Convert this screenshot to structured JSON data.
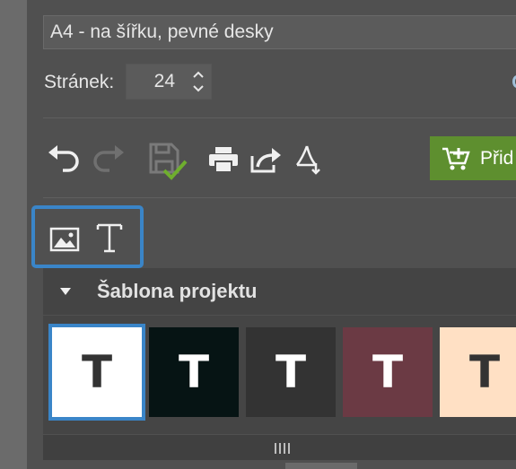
{
  "format": {
    "value": "A4 - na šířku, pevné desky"
  },
  "pages": {
    "label": "Stránek:",
    "value": "24"
  },
  "toolbar": {
    "icons": [
      "undo-icon",
      "redo-icon",
      "save-icon",
      "print-icon",
      "share-icon",
      "pdf-icon"
    ],
    "add_label": "Přid"
  },
  "element_tabs": {
    "icons": [
      "image-icon",
      "text-icon"
    ]
  },
  "template_section": {
    "title": "Šablona projektu",
    "swatches": [
      {
        "letter": "T",
        "bg": "#ffffff",
        "fg": "#333333",
        "selected": true
      },
      {
        "letter": "T",
        "bg": "#061414",
        "fg": "#ffffff",
        "selected": false
      },
      {
        "letter": "T",
        "bg": "#333333",
        "fg": "#ffffff",
        "selected": false
      },
      {
        "letter": "T",
        "bg": "#6b3a44",
        "fg": "#ffffff",
        "selected": false
      },
      {
        "letter": "T",
        "bg": "#ffe0c4",
        "fg": "#333333",
        "selected": false
      }
    ]
  },
  "colors": {
    "accent": "#3a85c8",
    "add_button": "#5e8f2f",
    "check": "#6fae2e"
  }
}
